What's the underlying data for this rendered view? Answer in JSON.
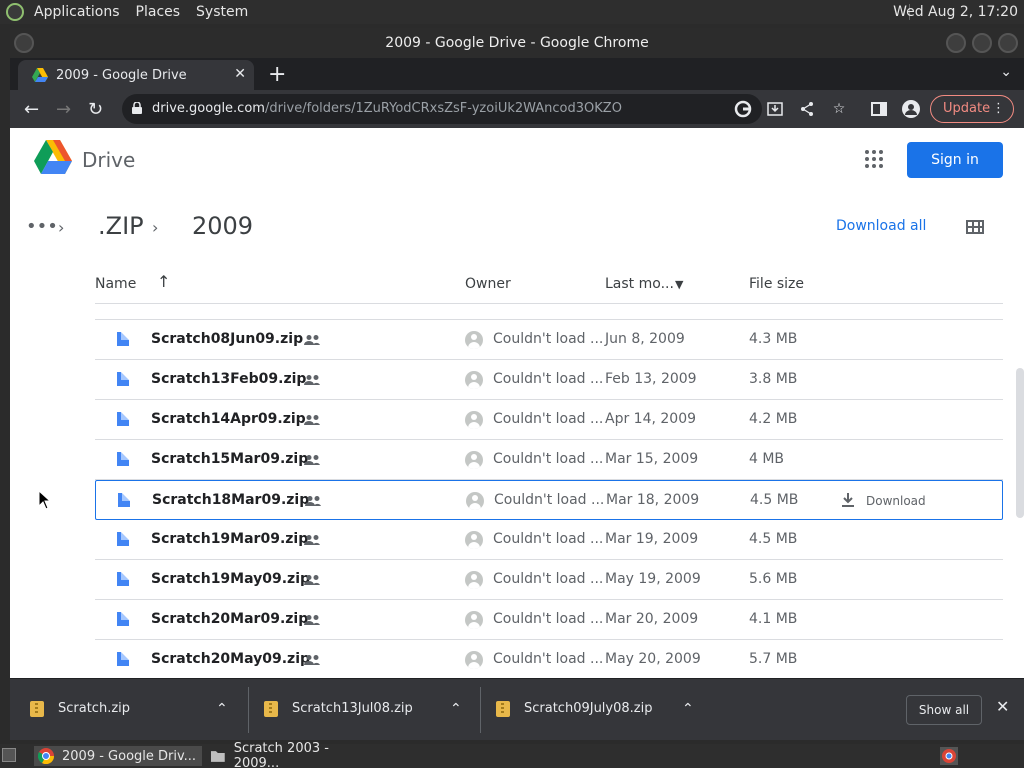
{
  "os_panel": {
    "menus": [
      "Applications",
      "Places",
      "System"
    ],
    "clock": "Wed Aug  2, 17:20"
  },
  "window": {
    "title": "2009 - Google Drive - Google Chrome"
  },
  "tab": {
    "title": "2009 - Google Drive",
    "close": "✕",
    "new_tab": "+"
  },
  "toolbar": {
    "url_host": "drive.google.com",
    "url_path": "/drive/folders/1ZuRYodCRxsZsF-yzoiUk2WAncod3OKZO",
    "update_label": "Update"
  },
  "drive": {
    "product_name": "Drive",
    "signin_label": "Sign in",
    "breadcrumb": [
      ".ZIP",
      "2009"
    ],
    "download_all": "Download all",
    "columns": {
      "name": "Name",
      "owner": "Owner",
      "modified": "Last mo...",
      "size": "File size"
    },
    "sort": "Name ascending",
    "files": [
      {
        "name": "Scratch08Jun09.zip",
        "owner": "Couldn't load ...",
        "modified": "Jun 8, 2009",
        "size": "4.3 MB"
      },
      {
        "name": "Scratch13Feb09.zip",
        "owner": "Couldn't load ...",
        "modified": "Feb 13, 2009",
        "size": "3.8 MB"
      },
      {
        "name": "Scratch14Apr09.zip",
        "owner": "Couldn't load ...",
        "modified": "Apr 14, 2009",
        "size": "4.2 MB"
      },
      {
        "name": "Scratch15Mar09.zip",
        "owner": "Couldn't load ...",
        "modified": "Mar 15, 2009",
        "size": "4 MB"
      },
      {
        "name": "Scratch18Mar09.zip",
        "owner": "Couldn't load ...",
        "modified": "Mar 18, 2009",
        "size": "4.5 MB",
        "selected": true,
        "action": "Download"
      },
      {
        "name": "Scratch19Mar09.zip",
        "owner": "Couldn't load ...",
        "modified": "Mar 19, 2009",
        "size": "4.5 MB"
      },
      {
        "name": "Scratch19May09.zip",
        "owner": "Couldn't load ...",
        "modified": "May 19, 2009",
        "size": "5.6 MB"
      },
      {
        "name": "Scratch20Mar09.zip",
        "owner": "Couldn't load ...",
        "modified": "Mar 20, 2009",
        "size": "4.1 MB"
      },
      {
        "name": "Scratch20May09.zip",
        "owner": "Couldn't load ...",
        "modified": "May 20, 2009",
        "size": "5.7 MB"
      }
    ]
  },
  "downloads": {
    "items": [
      "Scratch.zip",
      "Scratch13Jul08.zip",
      "Scratch09July08.zip"
    ],
    "show_all": "Show all"
  },
  "taskbar": {
    "tasks": [
      "2009 - Google Driv...",
      "Scratch 2003 - 2009..."
    ]
  },
  "colors": {
    "accent": "#1a73e8",
    "update": "#f28b82",
    "file_icon": "#4285f4"
  }
}
